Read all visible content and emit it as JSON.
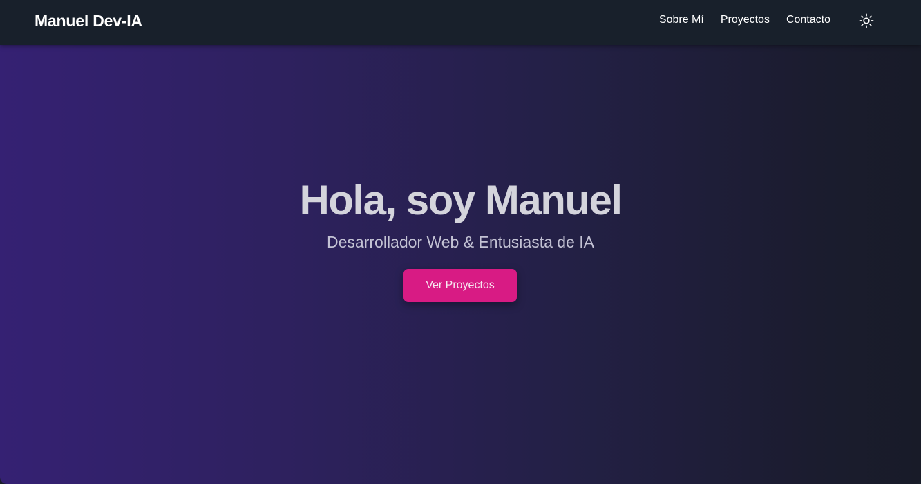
{
  "navbar": {
    "brand": "Manuel Dev-IA",
    "links": [
      {
        "label": "Sobre Mí"
      },
      {
        "label": "Proyectos"
      },
      {
        "label": "Contacto"
      }
    ],
    "theme_toggle_icon": "sun-icon"
  },
  "hero": {
    "title": "Hola, soy Manuel",
    "subtitle": "Desarrollador Web & Entusiasta de IA",
    "cta_label": "Ver Proyectos"
  },
  "colors": {
    "navbar_bg": "#18202b",
    "hero_gradient_start": "#352173",
    "hero_gradient_end": "#181b28",
    "accent": "#d81b84",
    "title_text": "#d4d4dc",
    "subtitle_text": "#c3c2d4"
  }
}
